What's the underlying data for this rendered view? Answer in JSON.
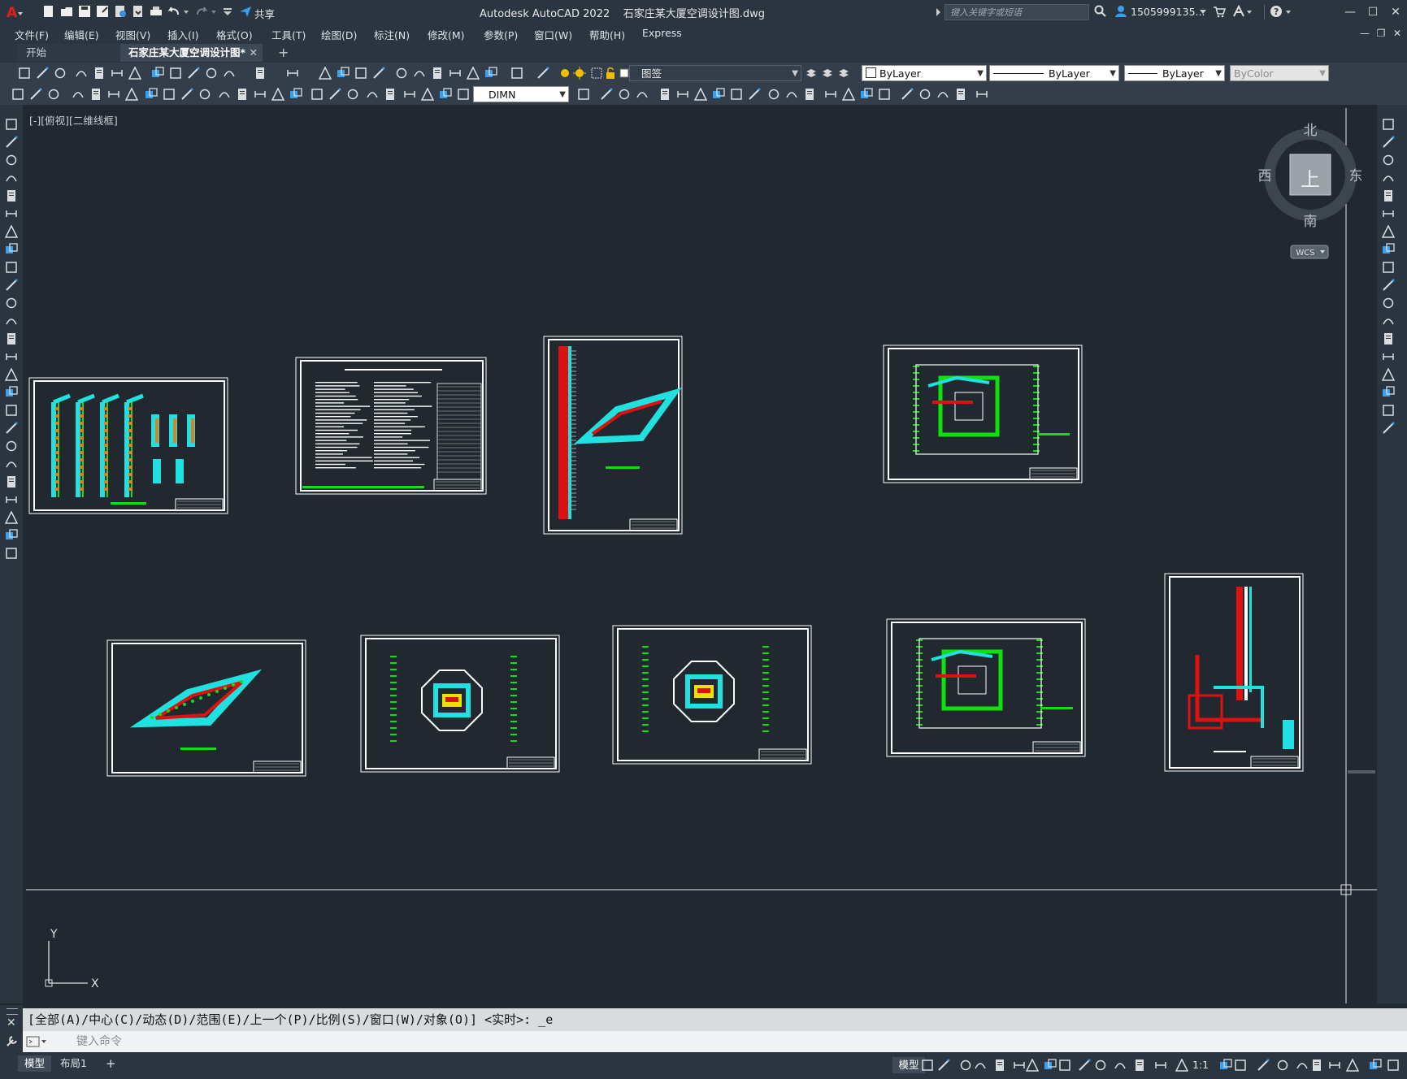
{
  "title_bar": {
    "app_title": "Autodesk AutoCAD 2022",
    "file_name": "石家庄某大厦空调设计图.dwg",
    "share_label": "共享",
    "search_placeholder": "键入关键字或短语",
    "user_name": "1505999135...",
    "app_icon": "autocad-a-icon"
  },
  "menu": {
    "items": [
      "文件(F)",
      "编辑(E)",
      "视图(V)",
      "插入(I)",
      "格式(O)",
      "工具(T)",
      "绘图(D)",
      "标注(N)",
      "修改(M)",
      "参数(P)",
      "窗口(W)",
      "帮助(H)",
      "Express"
    ]
  },
  "tabs": {
    "start": "开始",
    "active": "石家庄某大厦空调设计图*",
    "add": "+"
  },
  "toolbar": {
    "layer_name": "图签",
    "color": "ByLayer",
    "linetype": "ByLayer",
    "lineweight": "ByLayer",
    "plotstyle": "ByColor",
    "dim_style": "DIMN"
  },
  "viewport": {
    "label": "[-][俯视][二维线框]"
  },
  "viewcube": {
    "north": "北",
    "south": "南",
    "east": "东",
    "west": "西",
    "top": "上",
    "wcs": "WCS"
  },
  "ucs": {
    "x": "X",
    "y": "Y"
  },
  "command": {
    "history": "[全部(A)/中心(C)/动态(D)/范围(E)/上一个(P)/比例(S)/窗口(W)/对象(O)] <实时>: _e",
    "placeholder": "键入命令"
  },
  "status": {
    "model_tab": "模型",
    "layout_tab": "布局1",
    "add_tab": "+",
    "scale": "1:1"
  },
  "colors": {
    "canvas": "#212830",
    "chrome": "#2b3540",
    "accent_cyan": "#20e0e0",
    "accent_red": "#e01010",
    "accent_green": "#10e010",
    "accent_yellow": "#f0e000"
  }
}
